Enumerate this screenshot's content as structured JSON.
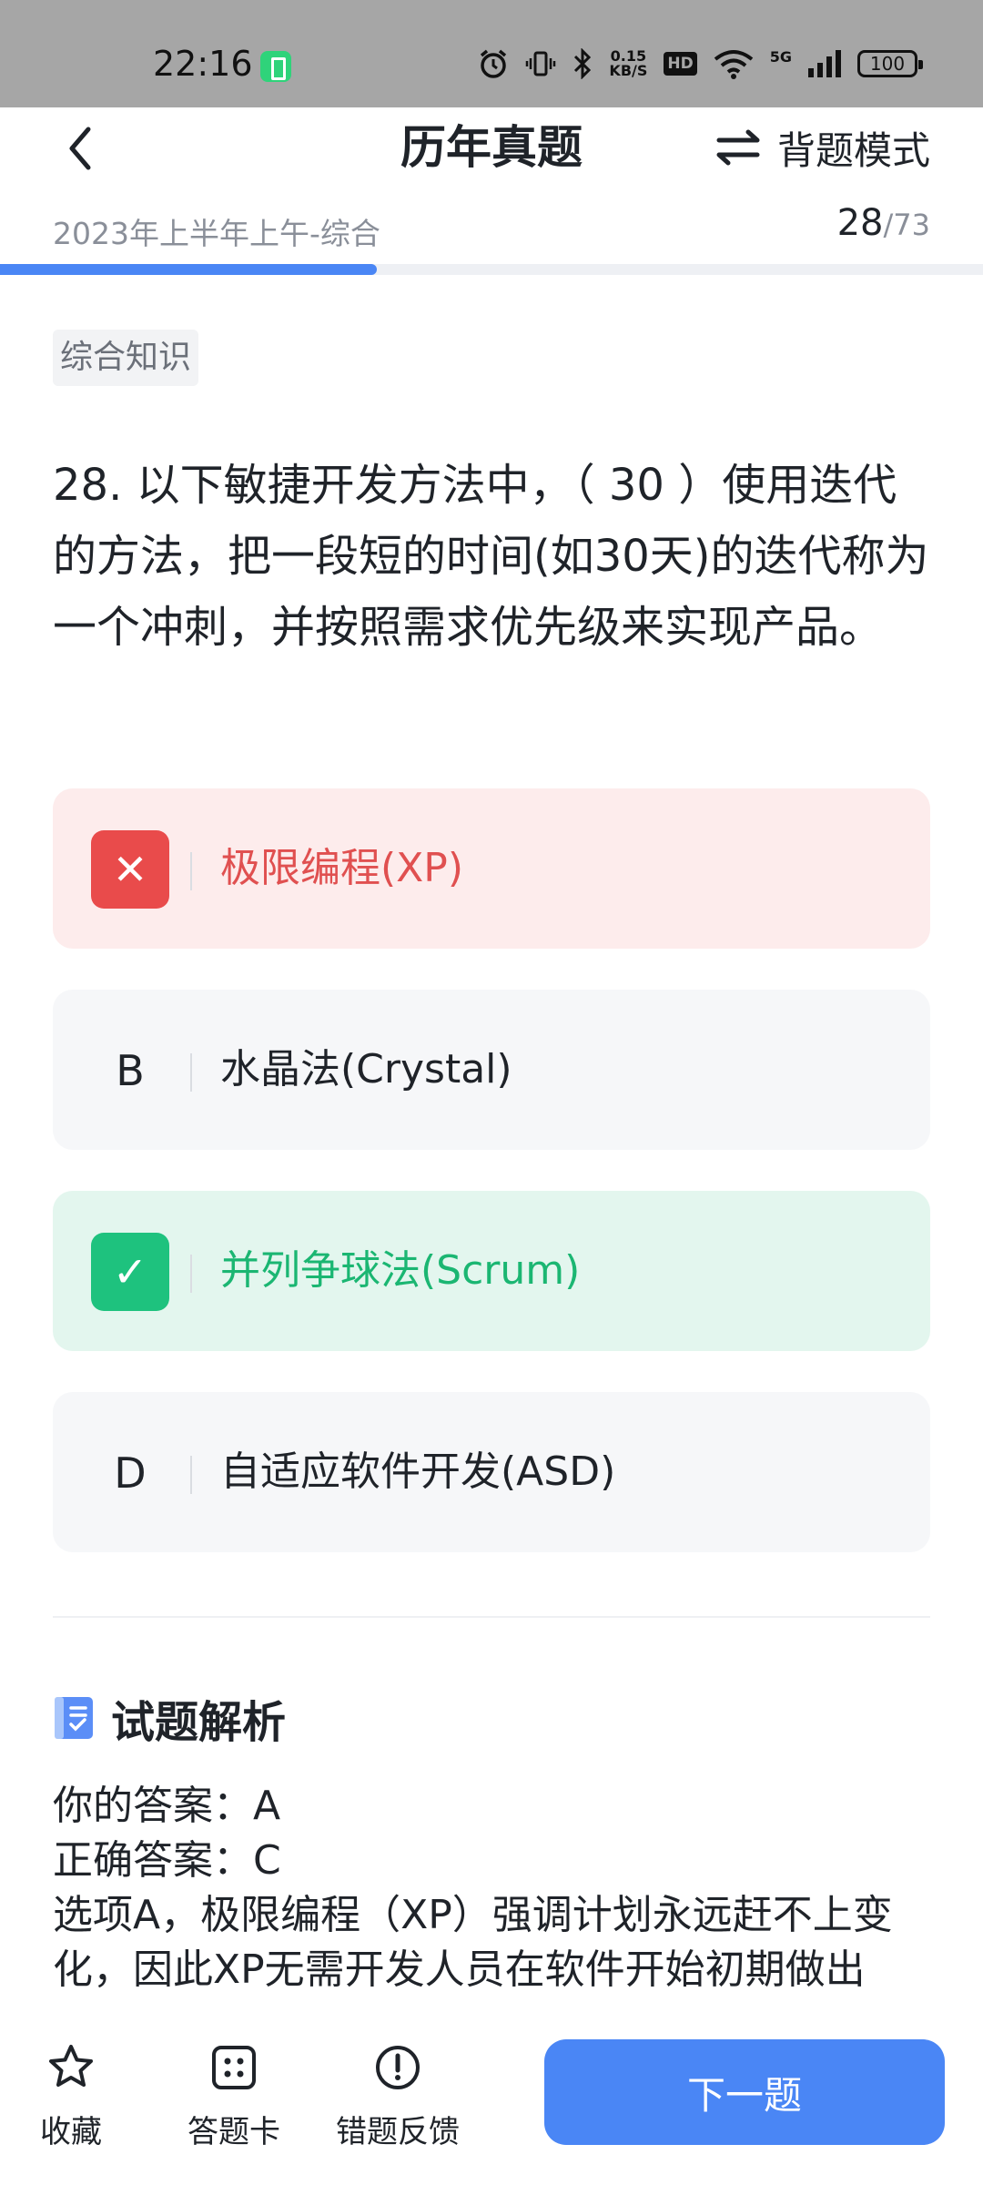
{
  "status_bar": {
    "time": "22:16",
    "net_speed_top": "0.15",
    "net_speed_bottom": "KB/S",
    "hd": "HD",
    "network": "5G",
    "battery": "100"
  },
  "header": {
    "title": "历年真题",
    "mode_label": "背题模式"
  },
  "sub_header": {
    "exam_name": "2023年上半年上午-综合",
    "current": "28",
    "total": "/73",
    "progress_fraction": 0.3836
  },
  "category_tag": "综合知识",
  "question": {
    "text": "28. 以下敏捷开发方法中，（ 30 ）使用迭代的方法，把一段短的时间(如30天)的迭代称为一个冲刺，并按照需求优先级来实现产品。"
  },
  "options": [
    {
      "marker": "✕",
      "text": "极限编程(XP)",
      "state": "wrong"
    },
    {
      "marker": "B",
      "text": "水晶法(Crystal)",
      "state": "normal"
    },
    {
      "marker": "✓",
      "text": "并列争球法(Scrum)",
      "state": "correct"
    },
    {
      "marker": "D",
      "text": "自适应软件开发(ASD)",
      "state": "normal"
    }
  ],
  "analysis": {
    "title": "试题解析",
    "your_answer": "你的答案：A",
    "correct_answer": "正确答案：C",
    "explanation": "选项A，极限编程（XP）强调计划永远赶不上变化，因此XP无需开发人员在软件开始初期做出"
  },
  "bottom_bar": {
    "favorite_label": "收藏",
    "answer_card_label": "答题卡",
    "feedback_label": "错题反馈",
    "next_label": "下一题"
  },
  "colors": {
    "accent": "#4a86f5",
    "wrong": "#e94b4b",
    "correct": "#1ec27e"
  }
}
